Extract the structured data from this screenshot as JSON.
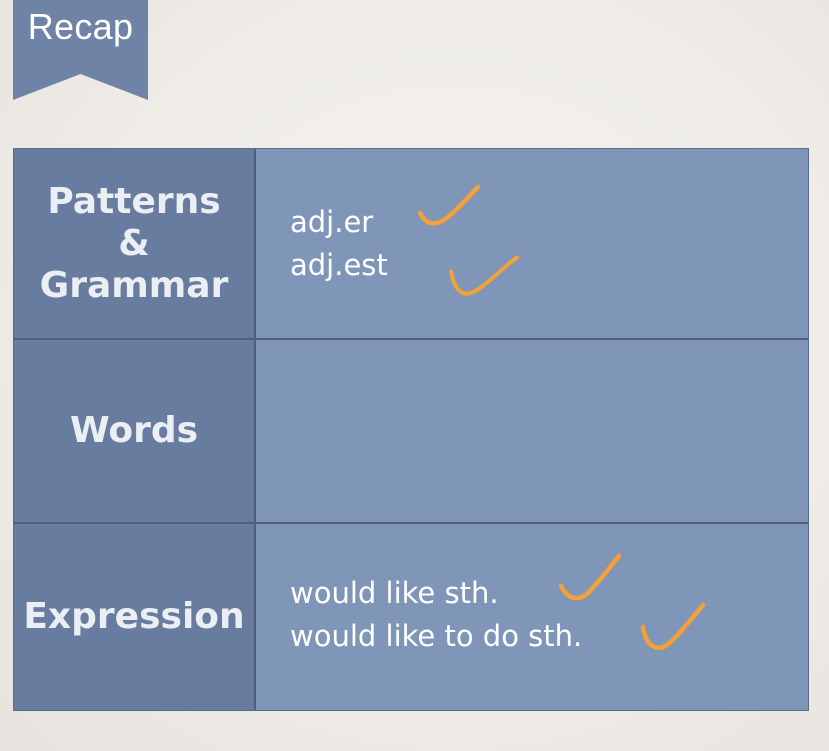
{
  "banner": {
    "title": "Recap"
  },
  "rows": [
    {
      "heading": "Patterns\n&\nGrammar",
      "entries": [
        "adj.er",
        "adj.est"
      ]
    },
    {
      "heading": "Words",
      "entries": []
    },
    {
      "heading": "Expression",
      "entries": [
        "would like sth.",
        "would like to do sth."
      ]
    }
  ],
  "colors": {
    "banner": "#6f83a6",
    "header_cell": "#687c9f",
    "content_cell": "#7f96b8",
    "check_mark": "#f5a135"
  },
  "icons": {
    "check": "checkmark-icon"
  }
}
